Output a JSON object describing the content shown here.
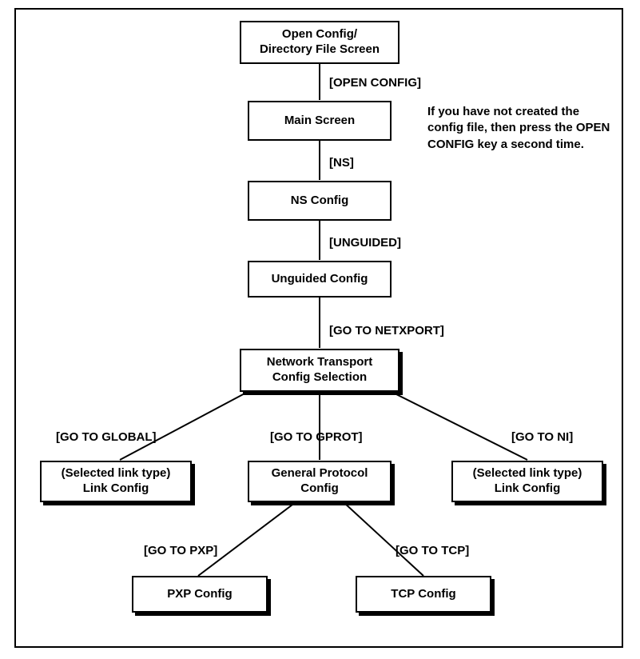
{
  "nodes": {
    "open_config": {
      "line1": "Open Config/",
      "line2": "Directory File Screen"
    },
    "main_screen": {
      "line1": "Main Screen"
    },
    "ns_config": {
      "line1": "NS Config"
    },
    "unguided_config": {
      "line1": "Unguided Config"
    },
    "net_transport": {
      "line1": "Network Transport",
      "line2": "Config Selection"
    },
    "link_config_left": {
      "line1": "(Selected link type)",
      "line2": "Link Config"
    },
    "general_protocol": {
      "line1": "General Protocol",
      "line2": "Config"
    },
    "link_config_right": {
      "line1": "(Selected link type)",
      "line2": "Link Config"
    },
    "pxp_config": {
      "line1": "PXP Config"
    },
    "tcp_config": {
      "line1": "TCP Config"
    }
  },
  "edges": {
    "open_to_main": "[OPEN CONFIG]",
    "main_to_ns": "[NS]",
    "ns_to_unguided": "[UNGUIDED]",
    "unguided_to_net": "[GO TO NETXPORT]",
    "net_to_global": "[GO TO GLOBAL]",
    "net_to_gprot": "[GO TO GPROT]",
    "net_to_ni": "[GO TO NI]",
    "gprot_to_pxp": "[GO TO PXP]",
    "gprot_to_tcp": "[GO TO TCP]"
  },
  "note": "If you have not created the config file, then press the OPEN CONFIG key a second time.",
  "chart_data": {
    "type": "flowchart",
    "nodes": [
      {
        "id": "open_config",
        "label": "Open Config/ Directory File Screen",
        "shadow": false
      },
      {
        "id": "main_screen",
        "label": "Main Screen",
        "shadow": false
      },
      {
        "id": "ns_config",
        "label": "NS Config",
        "shadow": false
      },
      {
        "id": "unguided_config",
        "label": "Unguided Config",
        "shadow": false
      },
      {
        "id": "net_transport",
        "label": "Network Transport Config Selection",
        "shadow": true
      },
      {
        "id": "link_config_left",
        "label": "(Selected link type) Link Config",
        "shadow": true
      },
      {
        "id": "general_protocol",
        "label": "General Protocol Config",
        "shadow": true
      },
      {
        "id": "link_config_right",
        "label": "(Selected link type) Link Config",
        "shadow": true
      },
      {
        "id": "pxp_config",
        "label": "PXP Config",
        "shadow": true
      },
      {
        "id": "tcp_config",
        "label": "TCP Config",
        "shadow": true
      }
    ],
    "edges": [
      {
        "from": "open_config",
        "to": "main_screen",
        "label": "[OPEN CONFIG]"
      },
      {
        "from": "main_screen",
        "to": "ns_config",
        "label": "[NS]"
      },
      {
        "from": "ns_config",
        "to": "unguided_config",
        "label": "[UNGUIDED]"
      },
      {
        "from": "unguided_config",
        "to": "net_transport",
        "label": "[GO TO NETXPORT]"
      },
      {
        "from": "net_transport",
        "to": "link_config_left",
        "label": "[GO TO GLOBAL]"
      },
      {
        "from": "net_transport",
        "to": "general_protocol",
        "label": "[GO TO GPROT]"
      },
      {
        "from": "net_transport",
        "to": "link_config_right",
        "label": "[GO TO NI]"
      },
      {
        "from": "general_protocol",
        "to": "pxp_config",
        "label": "[GO TO PXP]"
      },
      {
        "from": "general_protocol",
        "to": "tcp_config",
        "label": "[GO TO TCP]"
      }
    ],
    "annotations": [
      {
        "text": "If you have not created the config file, then press the OPEN CONFIG key a second time.",
        "position": "upper-right"
      }
    ]
  }
}
